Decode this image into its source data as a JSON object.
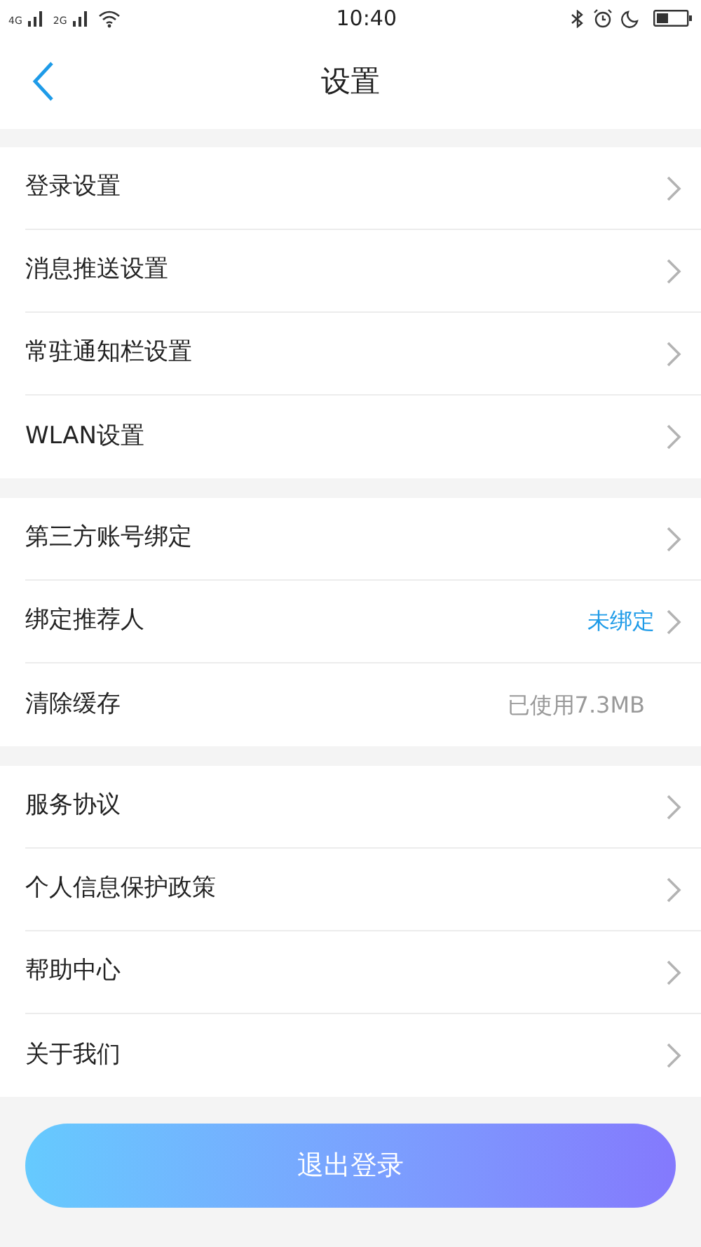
{
  "status_bar": {
    "network_1": "4G",
    "network_2": "2G",
    "time": "10:40"
  },
  "header": {
    "title": "设置"
  },
  "groups": [
    {
      "rows": [
        {
          "label": "登录设置",
          "chevron": true
        },
        {
          "label": "消息推送设置",
          "chevron": true
        },
        {
          "label": "常驻通知栏设置",
          "chevron": true
        },
        {
          "label": "WLAN设置",
          "chevron": true
        }
      ]
    },
    {
      "rows": [
        {
          "label": "第三方账号绑定",
          "chevron": true
        },
        {
          "label": "绑定推荐人",
          "chevron": true,
          "value": "未绑定",
          "value_highlighted": true
        },
        {
          "label": "清除缓存",
          "chevron": false,
          "value": "已使用7.3MB",
          "value_highlighted": false
        }
      ]
    },
    {
      "rows": [
        {
          "label": "服务协议",
          "chevron": true
        },
        {
          "label": "个人信息保护政策",
          "chevron": true
        },
        {
          "label": "帮助中心",
          "chevron": true
        },
        {
          "label": "关于我们",
          "chevron": true
        }
      ]
    }
  ],
  "logout_button": "退出登录"
}
